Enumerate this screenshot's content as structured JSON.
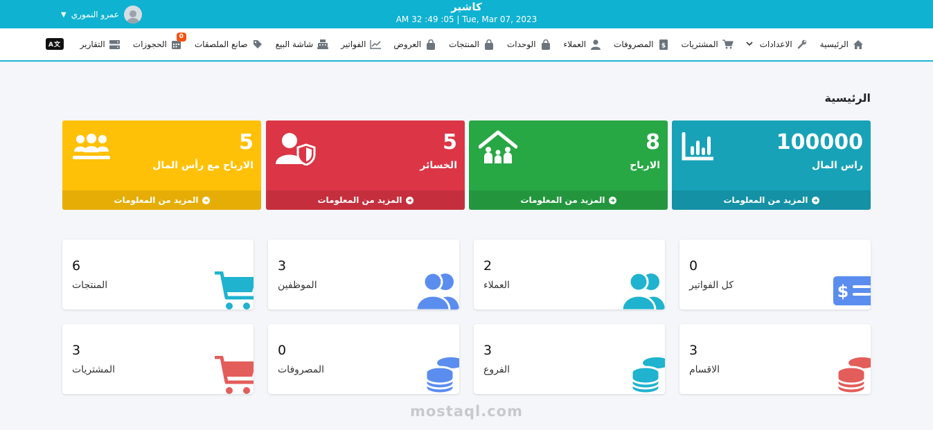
{
  "header": {
    "app_title": "كاشير",
    "datetime": "AM 32 :49 :05  |  Tue, Mar 07, 2023",
    "user_name": "عمرو النموري"
  },
  "nav": {
    "items": [
      {
        "label": "الرئيسية",
        "icon": "home-icon"
      },
      {
        "label": "الاعدادات",
        "icon": "wrench-icon"
      },
      {
        "label": "المشتريات",
        "icon": "cart-icon"
      },
      {
        "label": "المصروفات",
        "icon": "invoice-dollar-icon"
      },
      {
        "label": "العملاء",
        "icon": "user-icon"
      },
      {
        "label": "الوحدات",
        "icon": "bag-icon"
      },
      {
        "label": "المنتجات",
        "icon": "bag-icon"
      },
      {
        "label": "العروض",
        "icon": "bag-icon"
      },
      {
        "label": "الفواتير",
        "icon": "chart-line-icon"
      },
      {
        "label": "شاشة البيع",
        "icon": "cash-register-icon"
      },
      {
        "label": "صانع الملصقات",
        "icon": "tag-icon"
      },
      {
        "label": "الحجوزات",
        "icon": "calendar-icon",
        "badge": "0"
      },
      {
        "label": "التقارير",
        "icon": "server-icon"
      }
    ],
    "lang_label": "A文"
  },
  "page_title": "الرئيسية",
  "stats": [
    {
      "value": "100000",
      "label": "راس المال",
      "more": "المزيد من المعلومات",
      "color": "#17a2b8",
      "icon": "bar-chart-icon"
    },
    {
      "value": "8",
      "label": "الارباح",
      "more": "المزيد من المعلومات",
      "color": "#28a745",
      "icon": "family-house-icon"
    },
    {
      "value": "5",
      "label": "الخسائر",
      "more": "المزيد من المعلومات",
      "color": "#dc3545",
      "icon": "user-shield-icon"
    },
    {
      "value": "5",
      "label": "الارباح مع رأس المال",
      "more": "المزيد من المعلومات",
      "color": "#ffc107",
      "icon": "users-icon"
    }
  ],
  "counters": [
    {
      "value": "0",
      "label": "كل الفواتير",
      "icon": "money-check-icon",
      "color": "#5b8def"
    },
    {
      "value": "2",
      "label": "العملاء",
      "icon": "users-icon",
      "color": "#1fb3cf"
    },
    {
      "value": "3",
      "label": "الموظفين",
      "icon": "users-icon",
      "color": "#5b8def"
    },
    {
      "value": "6",
      "label": "المنتجات",
      "icon": "cart-icon",
      "color": "#1fb3cf"
    },
    {
      "value": "3",
      "label": "الاقسام",
      "icon": "coins-icon",
      "color": "#e35d5b"
    },
    {
      "value": "3",
      "label": "الفروع",
      "icon": "coins-icon",
      "color": "#1fb3cf"
    },
    {
      "value": "0",
      "label": "المصروفات",
      "icon": "coins-icon",
      "color": "#5b8def"
    },
    {
      "value": "3",
      "label": "المشتريات",
      "icon": "cart-icon",
      "color": "#e35d5b"
    }
  ],
  "watermark": "mostaql.com"
}
